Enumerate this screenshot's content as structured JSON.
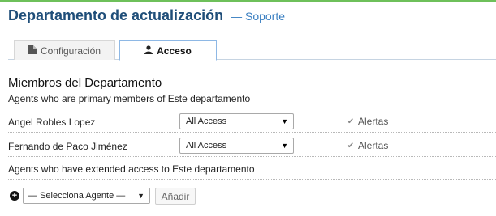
{
  "header": {
    "title": "Departamento de actualización",
    "separator": "—",
    "subtitle": "Soporte"
  },
  "tabs": [
    {
      "label": "Configuración",
      "icon": "file-icon",
      "active": false
    },
    {
      "label": "Acceso",
      "icon": "user-icon",
      "active": true
    }
  ],
  "members": {
    "title": "Miembros del Departamento",
    "subtitle": "Agents who are primary members of Este departamento",
    "rows": [
      {
        "name": "Angel Robles Lopez",
        "access": "All Access",
        "alert_label": "Alertas",
        "alert_checked": true
      },
      {
        "name": "Fernando de Paco Jiménez",
        "access": "All Access",
        "alert_label": "Alertas",
        "alert_checked": true
      }
    ]
  },
  "extended": {
    "text": "Agents who have extended access to Este departamento",
    "select_value": "— Selecciona Agente —",
    "add_label": "Añadir"
  },
  "colors": {
    "title": "#1f4e79",
    "subtitle": "#3a7fc1",
    "accent": "#6ec05a",
    "active_tab_border": "#8eb8e5"
  }
}
